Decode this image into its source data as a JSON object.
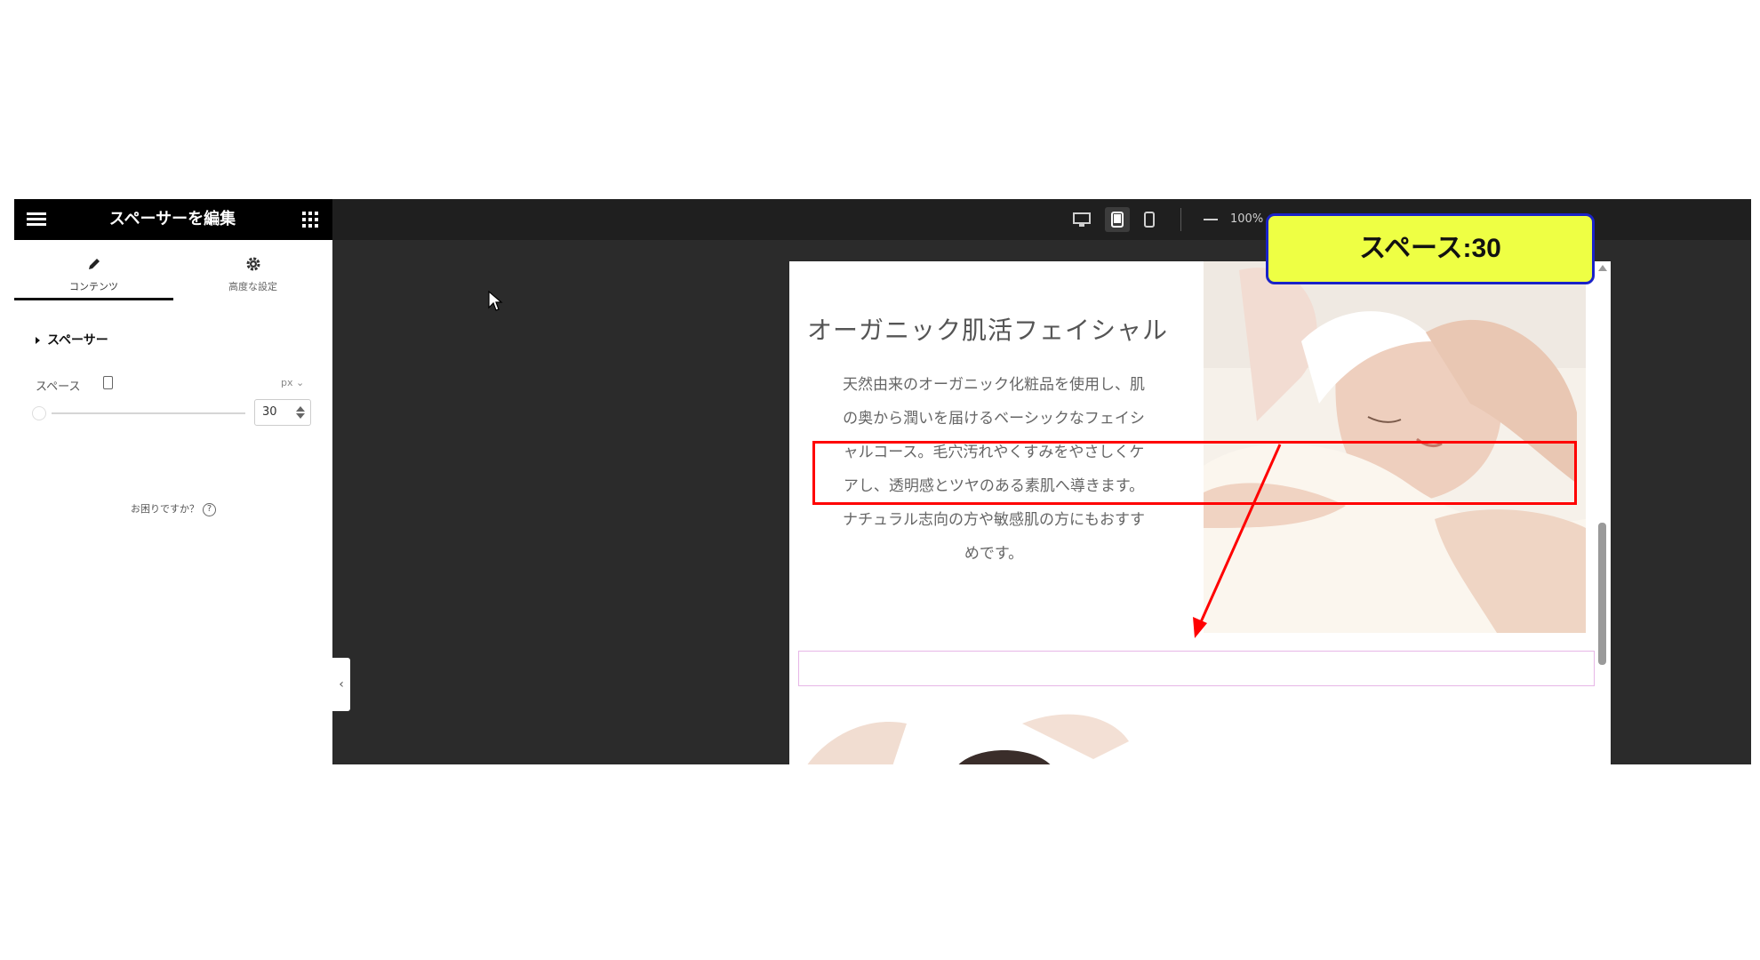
{
  "panel": {
    "title": "スペーサーを編集",
    "tabs": [
      {
        "label": "コンテンツ",
        "icon": "pencil-icon",
        "active": true
      },
      {
        "label": "高度な設定",
        "icon": "gear-icon",
        "active": false
      }
    ],
    "section_title": "スペーサー",
    "space_label": "スペース",
    "unit": "px",
    "space_value": "30",
    "help_text": "お困りですか？"
  },
  "toolbar": {
    "zoom": "100%",
    "active_device": "tablet"
  },
  "preview": {
    "heading": "オーガニック肌活フェイシャル",
    "body_lines": [
      "天然由来のオーガニック化粧品を使用し、肌",
      "の奥から潤いを届けるベーシックなフェイシ",
      "ャルコース。毛穴汚れやくすみをやさしくケ",
      "アし、透明感とツヤのある素肌へ導きます。",
      "ナチュラル志向の方や敏感肌の方にもおすす",
      "めです。"
    ]
  },
  "annotation": {
    "callout_text": "スペース:30",
    "callout_bg": "#eeff44",
    "callout_border": "#1a22c8",
    "highlight_color": "#ff0000"
  }
}
